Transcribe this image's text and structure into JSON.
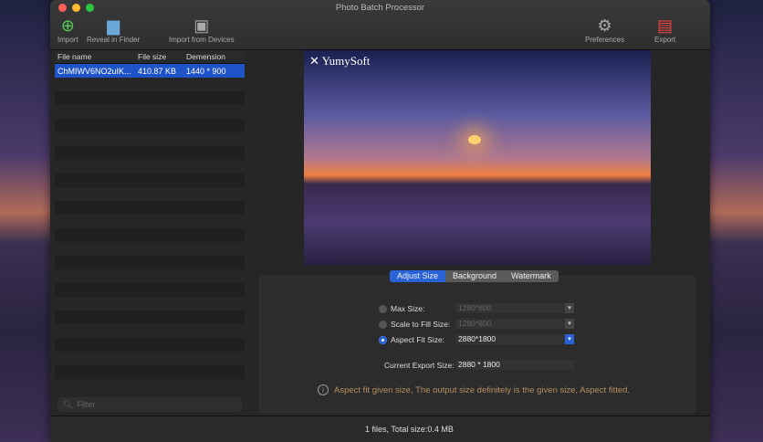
{
  "window": {
    "title": "Photo Batch Processor"
  },
  "toolbar": {
    "import": "Import",
    "reveal": "Reveal in Finder",
    "import_devices": "Import from Devices",
    "preferences": "Preferences",
    "export": "Export"
  },
  "list": {
    "headers": [
      "File name",
      "File size",
      "Demension"
    ],
    "rows": [
      {
        "name": "ChMIWV6NO2uIK...",
        "size": "410.87 KB",
        "dim": "1440 * 900"
      }
    ]
  },
  "filter": {
    "placeholder": "Filter"
  },
  "preview": {
    "logo": "YumySoft"
  },
  "tabs": [
    "Adjust Size",
    "Background",
    "Watermark"
  ],
  "options": {
    "max_label": "Max Size:",
    "max_value": "1280*800",
    "fill_label": "Scale to Fill Size:",
    "fill_value": "1280*800",
    "fit_label": "Aspect Fit Size:",
    "fit_value": "2880*1800",
    "selected": "Aspect Fit Size"
  },
  "export_size": {
    "label": "Current Export Size:",
    "value": "2880 * 1800"
  },
  "info": "Aspect fit given size, The output size definitely is the given size, Aspect fitted.",
  "status": "1 files, Total size:0.4 MB",
  "colors": {
    "accent": "#2a62d8",
    "info": "#b49060"
  }
}
